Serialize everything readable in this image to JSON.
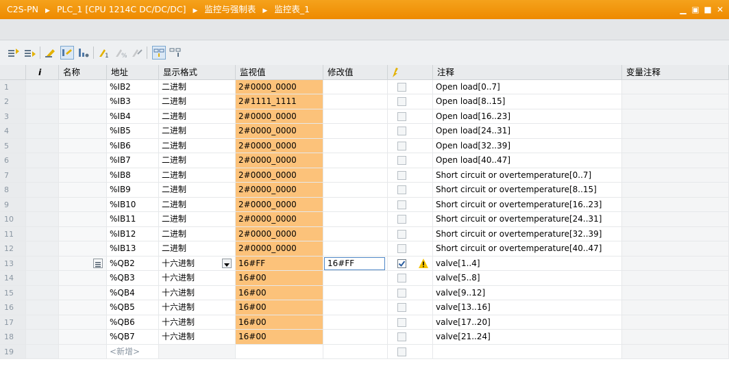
{
  "title": {
    "crumbs": [
      "C2S-PN",
      "PLC_1 [CPU 1214C DC/DC/DC]",
      "监控与强制表",
      "监控表_1"
    ]
  },
  "toolbar": {
    "icons": [
      "insert-row-icon",
      "add-row-icon",
      "rename-icon",
      "monitor-all-icon",
      "monitor-once-icon",
      "modify-now-icon",
      "modify-trigger-icon",
      "disable-periphery-icon",
      "show-modify-column-icon",
      "show-extended-column-icon"
    ]
  },
  "columns": {
    "num": "",
    "info": "i",
    "name": "名称",
    "address": "地址",
    "format": "显示格式",
    "monitor": "监视值",
    "modify": "修改值",
    "modify_flag": "",
    "comment": "注释",
    "tag_comment": "变量注释"
  },
  "rows": [
    {
      "n": "1",
      "address": "%IB2",
      "format": "二进制",
      "monitor": "2#0000_0000",
      "modify": "",
      "checked": false,
      "comment": "Open load[0..7]"
    },
    {
      "n": "2",
      "address": "%IB3",
      "format": "二进制",
      "monitor": "2#1111_1111",
      "modify": "",
      "checked": false,
      "comment": "Open load[8..15]"
    },
    {
      "n": "3",
      "address": "%IB4",
      "format": "二进制",
      "monitor": "2#0000_0000",
      "modify": "",
      "checked": false,
      "comment": "Open load[16..23]"
    },
    {
      "n": "4",
      "address": "%IB5",
      "format": "二进制",
      "monitor": "2#0000_0000",
      "modify": "",
      "checked": false,
      "comment": "Open load[24..31]"
    },
    {
      "n": "5",
      "address": "%IB6",
      "format": "二进制",
      "monitor": "2#0000_0000",
      "modify": "",
      "checked": false,
      "comment": "Open load[32..39]"
    },
    {
      "n": "6",
      "address": "%IB7",
      "format": "二进制",
      "monitor": "2#0000_0000",
      "modify": "",
      "checked": false,
      "comment": "Open load[40..47]"
    },
    {
      "n": "7",
      "address": "%IB8",
      "format": "二进制",
      "monitor": "2#0000_0000",
      "modify": "",
      "checked": false,
      "comment": "Short circuit or overtemperature[0..7]"
    },
    {
      "n": "8",
      "address": "%IB9",
      "format": "二进制",
      "monitor": "2#0000_0000",
      "modify": "",
      "checked": false,
      "comment": "Short circuit or overtemperature[8..15]"
    },
    {
      "n": "9",
      "address": "%IB10",
      "format": "二进制",
      "monitor": "2#0000_0000",
      "modify": "",
      "checked": false,
      "comment": "Short circuit or overtemperature[16..23]"
    },
    {
      "n": "10",
      "address": "%IB11",
      "format": "二进制",
      "monitor": "2#0000_0000",
      "modify": "",
      "checked": false,
      "comment": "Short circuit or overtemperature[24..31]"
    },
    {
      "n": "11",
      "address": "%IB12",
      "format": "二进制",
      "monitor": "2#0000_0000",
      "modify": "",
      "checked": false,
      "comment": "Short circuit or overtemperature[32..39]"
    },
    {
      "n": "12",
      "address": "%IB13",
      "format": "二进制",
      "monitor": "2#0000_0000",
      "modify": "",
      "checked": false,
      "comment": "Short circuit or overtemperature[40..47]"
    },
    {
      "n": "13",
      "address": "%QB2",
      "format": "十六进制",
      "monitor": "16#FF",
      "modify": "16#FF",
      "checked": true,
      "warning": true,
      "comment": "valve[1..4]"
    },
    {
      "n": "14",
      "address": "%QB3",
      "format": "十六进制",
      "monitor": "16#00",
      "modify": "",
      "checked": false,
      "comment": "valve[5..8]"
    },
    {
      "n": "15",
      "address": "%QB4",
      "format": "十六进制",
      "monitor": "16#00",
      "modify": "",
      "checked": false,
      "comment": "valve[9..12]"
    },
    {
      "n": "16",
      "address": "%QB5",
      "format": "十六进制",
      "monitor": "16#00",
      "modify": "",
      "checked": false,
      "comment": "valve[13..16]"
    },
    {
      "n": "17",
      "address": "%QB6",
      "format": "十六进制",
      "monitor": "16#00",
      "modify": "",
      "checked": false,
      "comment": "valve[17..20]"
    },
    {
      "n": "18",
      "address": "%QB7",
      "format": "十六进制",
      "monitor": "16#00",
      "modify": "",
      "checked": false,
      "comment": "valve[21..24]"
    }
  ],
  "new_row": {
    "n": "19",
    "address": "<新增>"
  },
  "colors": {
    "title_bar": "#ee8a00",
    "monitor_highlight": "#fcc27a",
    "warning": "#f5c400"
  }
}
